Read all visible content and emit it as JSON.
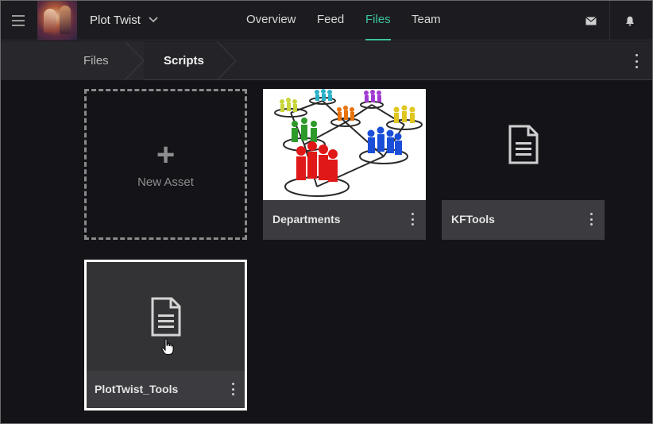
{
  "header": {
    "project_name": "Plot Twist",
    "tabs": [
      {
        "label": "Overview",
        "active": false
      },
      {
        "label": "Feed",
        "active": false
      },
      {
        "label": "Files",
        "active": true
      },
      {
        "label": "Team",
        "active": false
      }
    ],
    "icons": [
      "menu-icon",
      "chevron-down-icon",
      "mail-icon",
      "bell-icon"
    ]
  },
  "breadcrumb": {
    "items": [
      "Files",
      "Scripts"
    ],
    "more_icon": "more-vertical-icon"
  },
  "assets": {
    "new_asset_label": "New Asset",
    "items": [
      {
        "title": "Departments",
        "thumbnail": "network-people-image"
      },
      {
        "title": "KFTools",
        "thumbnail": "document-icon"
      },
      {
        "title": "PlotTwist_Tools",
        "thumbnail": "document-icon",
        "selected": true
      }
    ]
  },
  "colors": {
    "accent": "#3ec2a0",
    "background": "#141318",
    "card_footer": "#3c3c40"
  }
}
